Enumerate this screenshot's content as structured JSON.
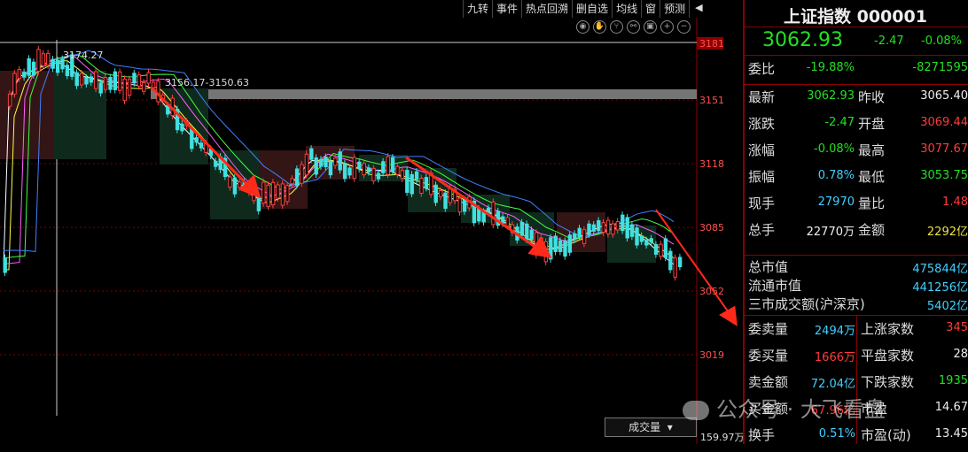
{
  "toolbar": {
    "items": [
      "九转",
      "事件",
      "热点回溯",
      "删自选",
      "均线",
      "窗",
      "预测"
    ],
    "arrow": "◀"
  },
  "chart_icons": [
    "eye-icon",
    "hand-icon",
    "fork-icon",
    "link-icon",
    "lock-icon",
    "zoom-in-icon",
    "zoom-out-icon"
  ],
  "chart_data": {
    "type": "candlestick",
    "y_ticks": [
      "3181",
      "3151",
      "3118",
      "3085",
      "3052",
      "3019"
    ],
    "annotations": [
      "3174.27",
      "3156.17-3150.63"
    ],
    "volume_label": "成交量",
    "volume_value": "159.97万",
    "ylim": [
      3000,
      3190
    ]
  },
  "panel": {
    "title": "上证指数  000001",
    "price": "3062.93",
    "change": "-2.47",
    "change_pct": "-0.08%",
    "rows": [
      {
        "l1": "委比",
        "v1": "-19.88%",
        "c1": "green",
        "l2": "",
        "v2": "-8271595",
        "c2": "green"
      },
      {
        "l1": "最新",
        "v1": "3062.93",
        "c1": "green",
        "l2": "昨收",
        "v2": "3065.40",
        "c2": "white"
      },
      {
        "l1": "涨跌",
        "v1": "-2.47",
        "c1": "green",
        "l2": "开盘",
        "v2": "3069.44",
        "c2": "red"
      },
      {
        "l1": "涨幅",
        "v1": "-0.08%",
        "c1": "green",
        "l2": "最高",
        "v2": "3077.67",
        "c2": "red"
      },
      {
        "l1": "振幅",
        "v1": "0.78%",
        "c1": "cyan",
        "l2": "最低",
        "v2": "3053.75",
        "c2": "green"
      },
      {
        "l1": "现手",
        "v1": "27970",
        "c1": "cyan",
        "l2": "量比",
        "v2": "1.48",
        "c2": "red"
      },
      {
        "l1": "总手",
        "v1": "22770万",
        "c1": "white",
        "l2": "金额",
        "v2": "2292亿",
        "c2": "yellow"
      }
    ],
    "market": [
      {
        "l": "总市值",
        "v": "475844亿"
      },
      {
        "l": "流通市值",
        "v": "441256亿"
      },
      {
        "l": "三市成交额(沪深京)",
        "v": "5402亿"
      }
    ],
    "bottom": [
      {
        "l1": "委卖量",
        "v1": "2494万",
        "c1": "cyan",
        "l2": "上涨家数",
        "v2": "345",
        "c2": "red"
      },
      {
        "l1": "委买量",
        "v1": "1666万",
        "c1": "red",
        "l2": "平盘家数",
        "v2": "28",
        "c2": "white"
      },
      {
        "l1": "卖金额",
        "v1": "72.04亿",
        "c1": "cyan",
        "l2": "下跌家数",
        "v2": "1935",
        "c2": "green"
      },
      {
        "l1": "买金额",
        "v1": "67.96亿",
        "c1": "red",
        "l2": "市盈",
        "v2": "14.67",
        "c2": "white"
      },
      {
        "l1": "换手",
        "v1": "0.51%",
        "c1": "cyan",
        "l2": "市盈(动)",
        "v2": "13.45",
        "c2": "white"
      }
    ]
  },
  "watermark": "公众号 · 大飞看盘"
}
